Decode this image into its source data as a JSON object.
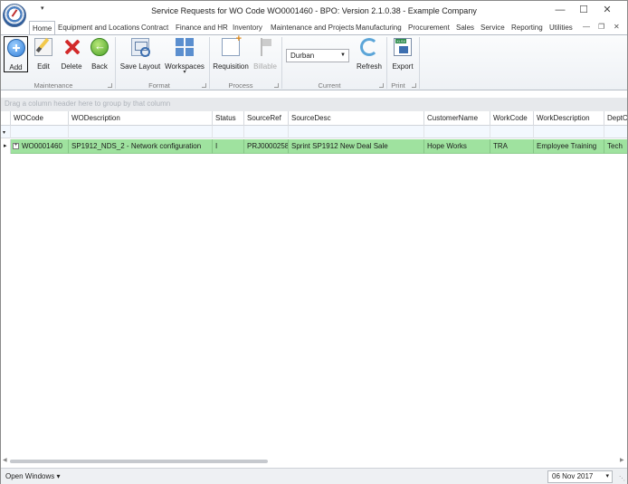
{
  "window": {
    "title": "Service Requests for WO Code WO0001460 - BPO: Version 2.1.0.38 - Example Company",
    "minimize": "—",
    "maximize": "☐",
    "close": "✕",
    "qat_arrow": "▾"
  },
  "tabs": [
    "Home",
    "Equipment and Locations",
    "Contract",
    "Finance and HR",
    "Inventory",
    "Maintenance and Projects",
    "Manufacturing",
    "Procurement",
    "Sales",
    "Service",
    "Reporting",
    "Utilities"
  ],
  "mdi_buttons": [
    "—",
    "❐",
    "✕"
  ],
  "ribbon": {
    "add": "Add",
    "edit": "Edit",
    "delete": "Delete",
    "back": "Back",
    "save_layout": "Save Layout",
    "workspaces": "Workspaces",
    "requisition": "Requisition",
    "billable": "Billable",
    "site_value": "Durban",
    "refresh": "Refresh",
    "export": "Export",
    "groups": {
      "maintenance": "Maintenance",
      "format": "Format",
      "process": "Process",
      "current": "Current",
      "print": "Print"
    }
  },
  "group_panel_hint": "Drag a column header here to group by that column",
  "grid": {
    "columns": [
      "WOCode",
      "WODescription",
      "Status",
      "SourceRef",
      "SourceDesc",
      "CustomerName",
      "WorkCode",
      "WorkDescription",
      "DeptCo"
    ],
    "filter_icon": "▾",
    "rows": [
      {
        "indicator": "▸",
        "expand": "+",
        "cells": [
          "WO0001460",
          "SP1912_NDS_2 - Network configuration",
          "I",
          "PRJ0000258",
          "Sprint SP1912 New Deal Sale",
          "Hope Works",
          "TRA",
          "Employee Training",
          "Tech"
        ]
      }
    ]
  },
  "status": {
    "open_windows": "Open Windows ▾",
    "date": "06 Nov 2017",
    "date_caret": "▾"
  },
  "colors": {
    "selected_row": "#9fe29f",
    "accent": "#2f7dd8"
  }
}
